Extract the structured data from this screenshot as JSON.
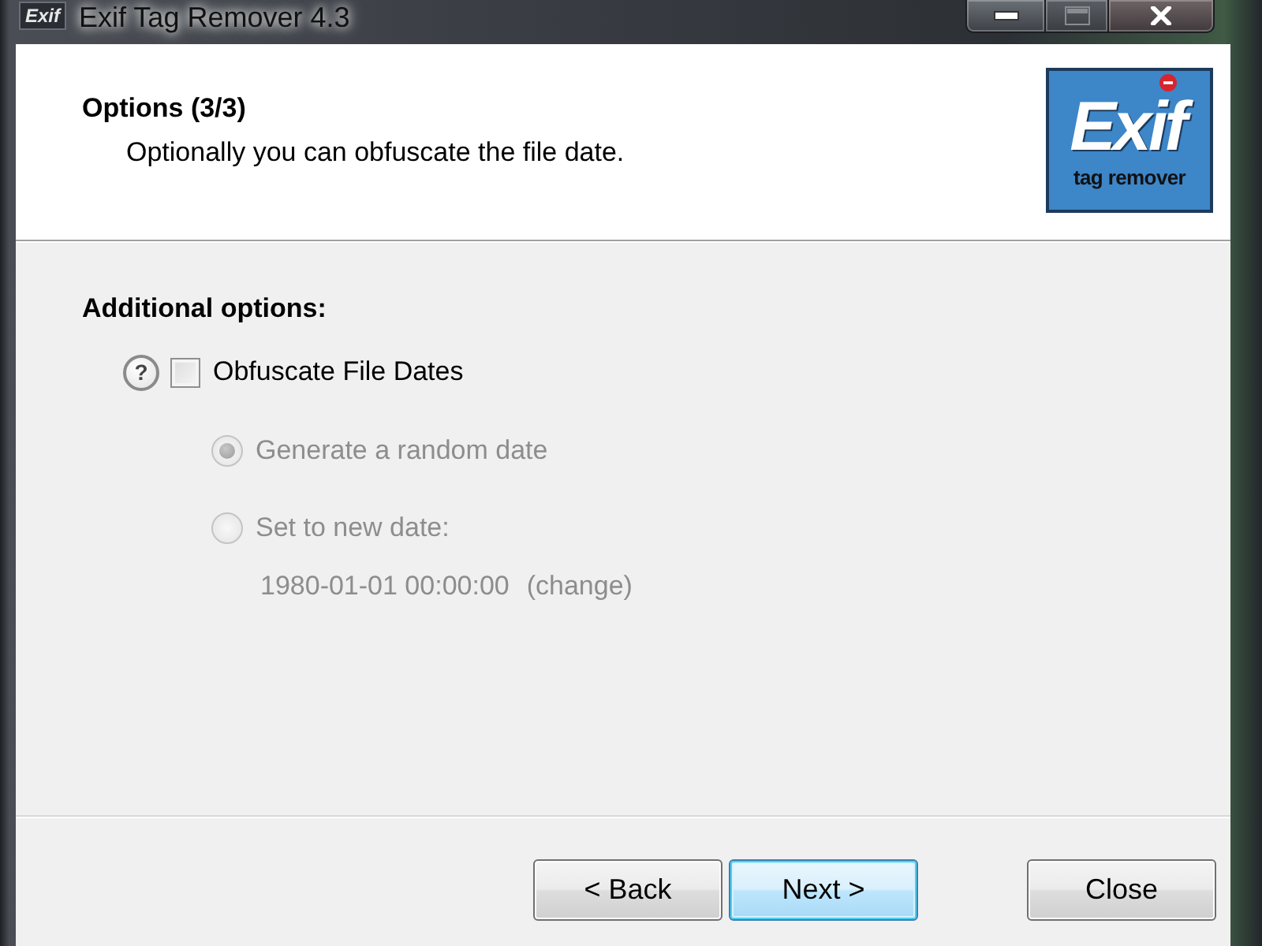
{
  "window": {
    "app_icon": "Exif",
    "title": "Exif Tag Remover 4.3",
    "controls": [
      {
        "kind": "minimize",
        "disabled": false
      },
      {
        "kind": "maximize",
        "disabled": true
      },
      {
        "kind": "close",
        "disabled": false
      }
    ]
  },
  "header": {
    "title": "Options (3/3)",
    "subtitle": "Optionally you can obfuscate the file date.",
    "logo": {
      "title": "Exif",
      "subtitle": "tag remover"
    }
  },
  "section": {
    "heading": "Additional options:",
    "help": "?",
    "obfuscate": {
      "label": "Obfuscate File Dates",
      "checked": false
    },
    "options": [
      {
        "label": "Generate a random date",
        "selected": true,
        "disabled": true
      },
      {
        "label": "Set to new date:",
        "selected": false,
        "disabled": true
      }
    ],
    "date": {
      "value": "1980-01-01 00:00:00",
      "link": "(change)",
      "disabled": true
    }
  },
  "buttons": [
    {
      "label": "< Back",
      "kind": "nav",
      "default": false
    },
    {
      "label": "Next >",
      "kind": "nav",
      "default": true
    },
    {
      "label": "Close",
      "kind": "cancel",
      "default": false
    }
  ]
}
